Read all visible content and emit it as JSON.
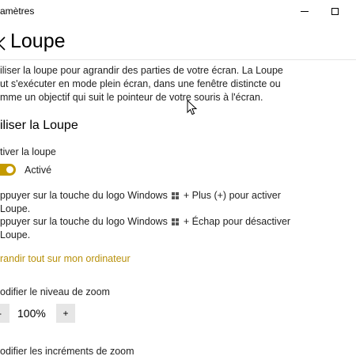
{
  "window": {
    "title": "amètres"
  },
  "header": {
    "title": "Loupe"
  },
  "description": {
    "lines": [
      "iliser la loupe pour agrandir des parties de votre écran. La Loupe",
      "ut s'exécuter en mode plein écran, dans une fenêtre distincte ou",
      "mme un objectif qui suit le pointeur de votre souris à l'écran."
    ]
  },
  "section": {
    "heading": "iliser la Loupe"
  },
  "toggle": {
    "label": "tiver la loupe",
    "state": "Activé",
    "on": true,
    "color": "#c49a00"
  },
  "hints": {
    "activate": {
      "before": "ppuyer sur la touche du logo Windows",
      "after": "+ Plus (+) pour activer",
      "line2": "Loupe."
    },
    "deactivate": {
      "before": "ppuyer sur la touche du logo Windows",
      "after": "+ Échap pour désactiver",
      "line2": "Loupe."
    },
    "icon": "windows-logo-icon"
  },
  "link": {
    "label": "randir tout sur mon ordinateur",
    "color": "#b8910c"
  },
  "zoom": {
    "label": "odifier le niveau de zoom",
    "minus_label": "-",
    "value": "100%",
    "plus_label": "+"
  },
  "increments": {
    "label": "odifier les incréments de zoom"
  }
}
